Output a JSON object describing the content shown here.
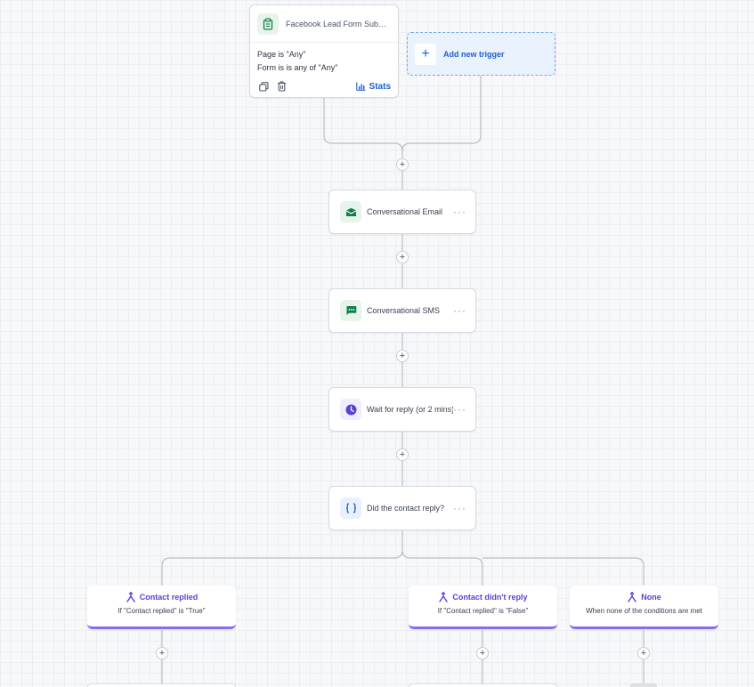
{
  "trigger": {
    "icon": "clipboard-icon",
    "title": "Facebook Lead Form Subm...",
    "conditions": [
      "Page is \"Any\"",
      "Form is is any of \"Any\""
    ],
    "stats_label": "Stats"
  },
  "add_trigger": {
    "label": "Add new trigger"
  },
  "actions": [
    {
      "icon": "email-icon",
      "label": "Conversational Email"
    },
    {
      "icon": "sms-icon",
      "label": "Conversational SMS"
    },
    {
      "icon": "clock-icon",
      "label": "Wait for reply (or 2 mins)"
    },
    {
      "icon": "braces-icon",
      "label": "Did the contact reply?"
    }
  ],
  "more_label": "···",
  "plus_label": "+",
  "branches": [
    {
      "title": "Contact replied",
      "subtitle": "If \"Contact replied\" is \"True\""
    },
    {
      "title": "Contact didn't reply",
      "subtitle": "If \"Contact replied\" is \"False\""
    },
    {
      "title": "None",
      "subtitle": "When none of the conditions are met"
    }
  ],
  "colors": {
    "accent_blue": "#1f5fd1",
    "branch_purple": "#8b6cf0",
    "green": "#12804a"
  }
}
